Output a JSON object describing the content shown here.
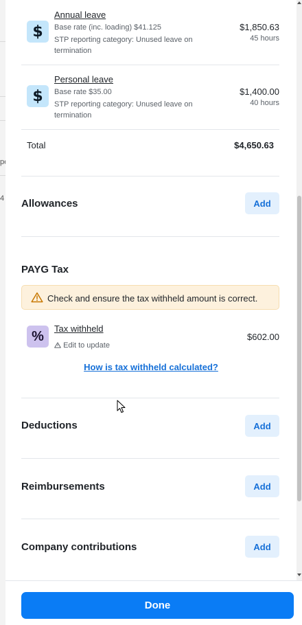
{
  "background_fragments": [
    "pe",
    "4"
  ],
  "leave_items": [
    {
      "name": "Annual leave",
      "rate": "Base rate (inc. loading) $41.125",
      "stp": "STP reporting category: Unused leave on termination",
      "amount": "$1,850.63",
      "hours": "45 hours",
      "icon": "dollar-icon"
    },
    {
      "name": "Personal leave",
      "rate": "Base rate $35.00",
      "stp": "STP reporting category: Unused leave on termination",
      "amount": "$1,400.00",
      "hours": "40 hours",
      "icon": "dollar-icon"
    }
  ],
  "total": {
    "label": "Total",
    "value": "$4,650.63"
  },
  "sections": {
    "allowances": {
      "title": "Allowances",
      "add_label": "Add"
    },
    "payg": {
      "title": "PAYG Tax",
      "alert": "Check and ensure the tax withheld amount is correct.",
      "tax_name": "Tax withheld",
      "tax_hint": "Edit to update",
      "tax_amount": "$602.00",
      "how_link": "How is tax withheld calculated?",
      "icon": "percent-icon"
    },
    "deductions": {
      "title": "Deductions",
      "add_label": "Add"
    },
    "reimbursements": {
      "title": "Reimbursements",
      "add_label": "Add"
    },
    "company_contributions": {
      "title": "Company contributions",
      "add_label": "Add"
    }
  },
  "footer": {
    "done_label": "Done"
  },
  "colors": {
    "primary": "#0a7cf5",
    "link": "#1670d8",
    "add_button_bg": "#e3f0fd",
    "dollar_icon_bg": "#c4e6fb",
    "percent_icon_bg": "#cdc2ee",
    "alert_bg": "#fdf1dd"
  }
}
